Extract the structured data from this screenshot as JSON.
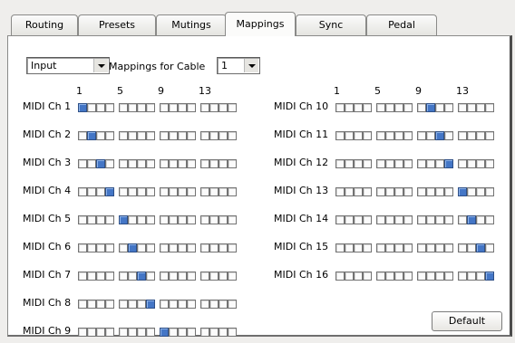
{
  "tabs": [
    {
      "label": "Routing",
      "active": false
    },
    {
      "label": "Presets",
      "active": false
    },
    {
      "label": "Mutings",
      "active": false
    },
    {
      "label": "Mappings",
      "active": true
    },
    {
      "label": "Sync",
      "active": false
    },
    {
      "label": "Pedal",
      "active": false
    }
  ],
  "direction_select": {
    "value": "Input"
  },
  "cable_label": "Mappings for Cable",
  "cable_select": {
    "value": "1"
  },
  "column_numbers": [
    "1",
    "5",
    "9",
    "13"
  ],
  "left_channels": [
    {
      "label": "MIDI Ch 1",
      "selected": 1
    },
    {
      "label": "MIDI Ch 2",
      "selected": 2
    },
    {
      "label": "MIDI Ch 3",
      "selected": 3
    },
    {
      "label": "MIDI Ch 4",
      "selected": 4
    },
    {
      "label": "MIDI Ch 5",
      "selected": 5
    },
    {
      "label": "MIDI Ch 6",
      "selected": 6
    },
    {
      "label": "MIDI Ch 7",
      "selected": 7
    },
    {
      "label": "MIDI Ch 8",
      "selected": 8
    },
    {
      "label": "MIDI Ch 9",
      "selected": 9
    }
  ],
  "right_channels": [
    {
      "label": "MIDI Ch 10",
      "selected": 10
    },
    {
      "label": "MIDI Ch 11",
      "selected": 11
    },
    {
      "label": "MIDI Ch 12",
      "selected": 12
    },
    {
      "label": "MIDI Ch 13",
      "selected": 13
    },
    {
      "label": "MIDI Ch 14",
      "selected": 14
    },
    {
      "label": "MIDI Ch 15",
      "selected": 15
    },
    {
      "label": "MIDI Ch 16",
      "selected": 16
    }
  ],
  "default_button": "Default",
  "colors": {
    "selected_cell": "#4476c6",
    "panel": "#ffffff",
    "window": "#efeeec"
  }
}
